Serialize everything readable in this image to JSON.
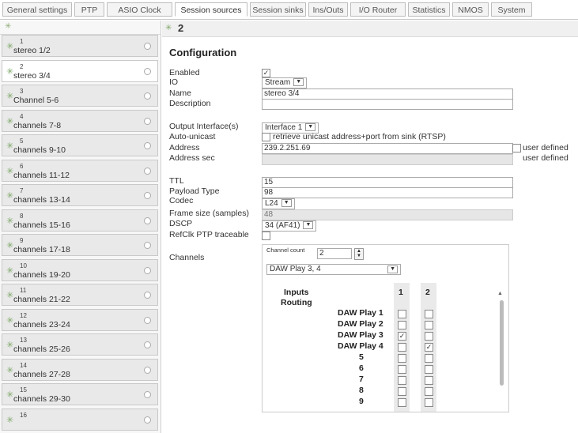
{
  "tabs": [
    "General settings",
    "PTP",
    "ASIO Clock",
    "Session sources",
    "Session sinks",
    "Ins/Outs",
    "I/O Router",
    "Statistics",
    "NMOS",
    "System"
  ],
  "active_tab": "Session sources",
  "sidebar": {
    "items": [
      {
        "num": "1",
        "label": "stereo 1/2"
      },
      {
        "num": "2",
        "label": "stereo 3/4"
      },
      {
        "num": "3",
        "label": "Channel 5-6"
      },
      {
        "num": "4",
        "label": "channels 7-8"
      },
      {
        "num": "5",
        "label": "channels 9-10"
      },
      {
        "num": "6",
        "label": "channels 11-12"
      },
      {
        "num": "7",
        "label": "channels 13-14"
      },
      {
        "num": "8",
        "label": "channels 15-16"
      },
      {
        "num": "9",
        "label": "channels 17-18"
      },
      {
        "num": "10",
        "label": "channels 19-20"
      },
      {
        "num": "11",
        "label": "channels 21-22"
      },
      {
        "num": "12",
        "label": "channels 23-24"
      },
      {
        "num": "13",
        "label": "channels 25-26"
      },
      {
        "num": "14",
        "label": "channels 27-28"
      },
      {
        "num": "15",
        "label": "channels 29-30"
      },
      {
        "num": "16",
        "label": ""
      }
    ]
  },
  "main": {
    "header": "2",
    "section_title": "Configuration",
    "enabled": {
      "label": "Enabled",
      "checked": true
    },
    "io": {
      "label": "IO",
      "value": "Stream"
    },
    "name": {
      "label": "Name",
      "value": "stereo 3/4"
    },
    "description": {
      "label": "Description",
      "value": ""
    },
    "output_interface": {
      "label": "Output Interface(s)",
      "value": "Interface 1"
    },
    "auto_unicast": {
      "label": "Auto-unicast",
      "text": "retrieve unicast address+port from sink (RTSP)"
    },
    "address": {
      "label": "Address",
      "value": "239.2.251.69",
      "user_defined": "user defined"
    },
    "address_sec": {
      "label": "Address sec",
      "value": "",
      "user_defined": "user defined"
    },
    "ttl": {
      "label": "TTL",
      "value": "15"
    },
    "payload_type": {
      "label": "Payload Type",
      "value": "98"
    },
    "codec": {
      "label": "Codec",
      "value": "L24"
    },
    "frame_size": {
      "label": "Frame size (samples)",
      "value": "48"
    },
    "dscp": {
      "label": "DSCP",
      "value": "34 (AF41)"
    },
    "refclk": {
      "label": "RefClk PTP traceable"
    },
    "channels": {
      "label": "Channels",
      "count_label": "Channel count",
      "count_value": "2",
      "source_select": "DAW Play 3, 4",
      "inputs_label": "Inputs",
      "routing_label": "Routing",
      "col_headers": [
        "1",
        "2"
      ],
      "rows": [
        {
          "label": "DAW Play 1",
          "c1": false,
          "c2": false
        },
        {
          "label": "DAW Play 2",
          "c1": false,
          "c2": false
        },
        {
          "label": "DAW Play 3",
          "c1": true,
          "c2": false
        },
        {
          "label": "DAW Play 4",
          "c1": false,
          "c2": true
        },
        {
          "label": "5",
          "c1": false,
          "c2": false
        },
        {
          "label": "6",
          "c1": false,
          "c2": false
        },
        {
          "label": "7",
          "c1": false,
          "c2": false
        },
        {
          "label": "8",
          "c1": false,
          "c2": false
        },
        {
          "label": "9",
          "c1": false,
          "c2": false
        }
      ]
    }
  },
  "icons": {
    "pin": "pin-icon",
    "status": "status-dot-icon",
    "plug": "plug-icon"
  },
  "colors": {
    "accent": "#7fa86a",
    "check_on": "#333333"
  }
}
